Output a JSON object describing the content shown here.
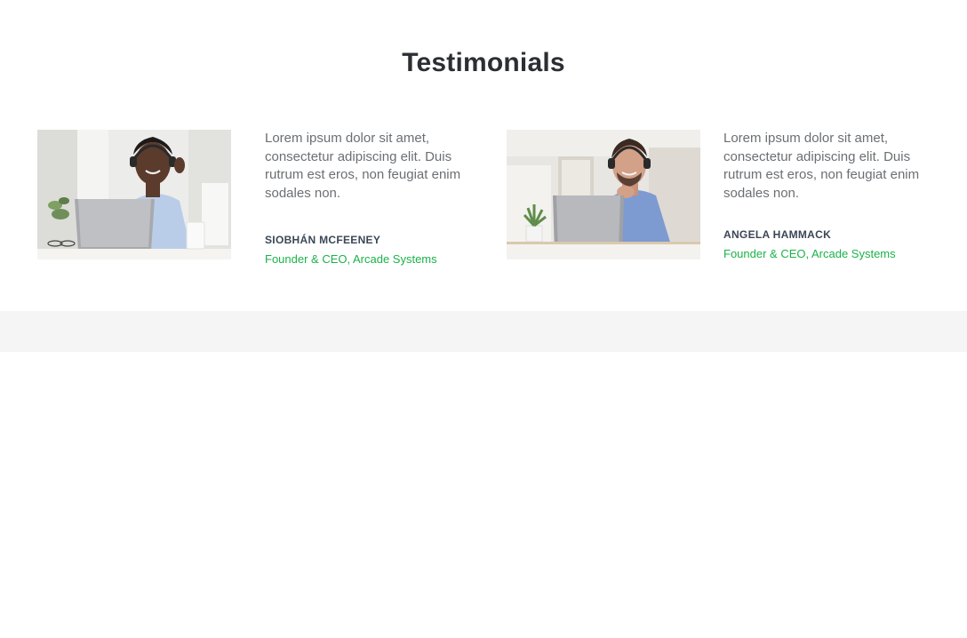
{
  "section": {
    "title": "Testimonials"
  },
  "testimonials": [
    {
      "photo_icon": "woman-with-headset-at-laptop-photo",
      "quote": "Lorem ipsum dolor sit amet, consectetur adipiscing elit. Duis rutrum est eros, non feugiat enim sodales non.",
      "name": "SIOBHÁN MCFEENEY",
      "role": "Founder & CEO, Arcade Systems"
    },
    {
      "photo_icon": "man-with-headset-at-laptop-photo",
      "quote": "Lorem ipsum dolor sit amet, consectetur adipiscing elit. Duis rutrum est eros, non feugiat enim sodales non.",
      "name": "ANGELA HAMMACK",
      "role": "Founder & CEO, Arcade Systems"
    }
  ],
  "colors": {
    "title": "#2b2f33",
    "body_text": "#6b6f73",
    "name": "#3b4656",
    "accent_green": "#1bb24a",
    "band": "#f5f5f5"
  }
}
